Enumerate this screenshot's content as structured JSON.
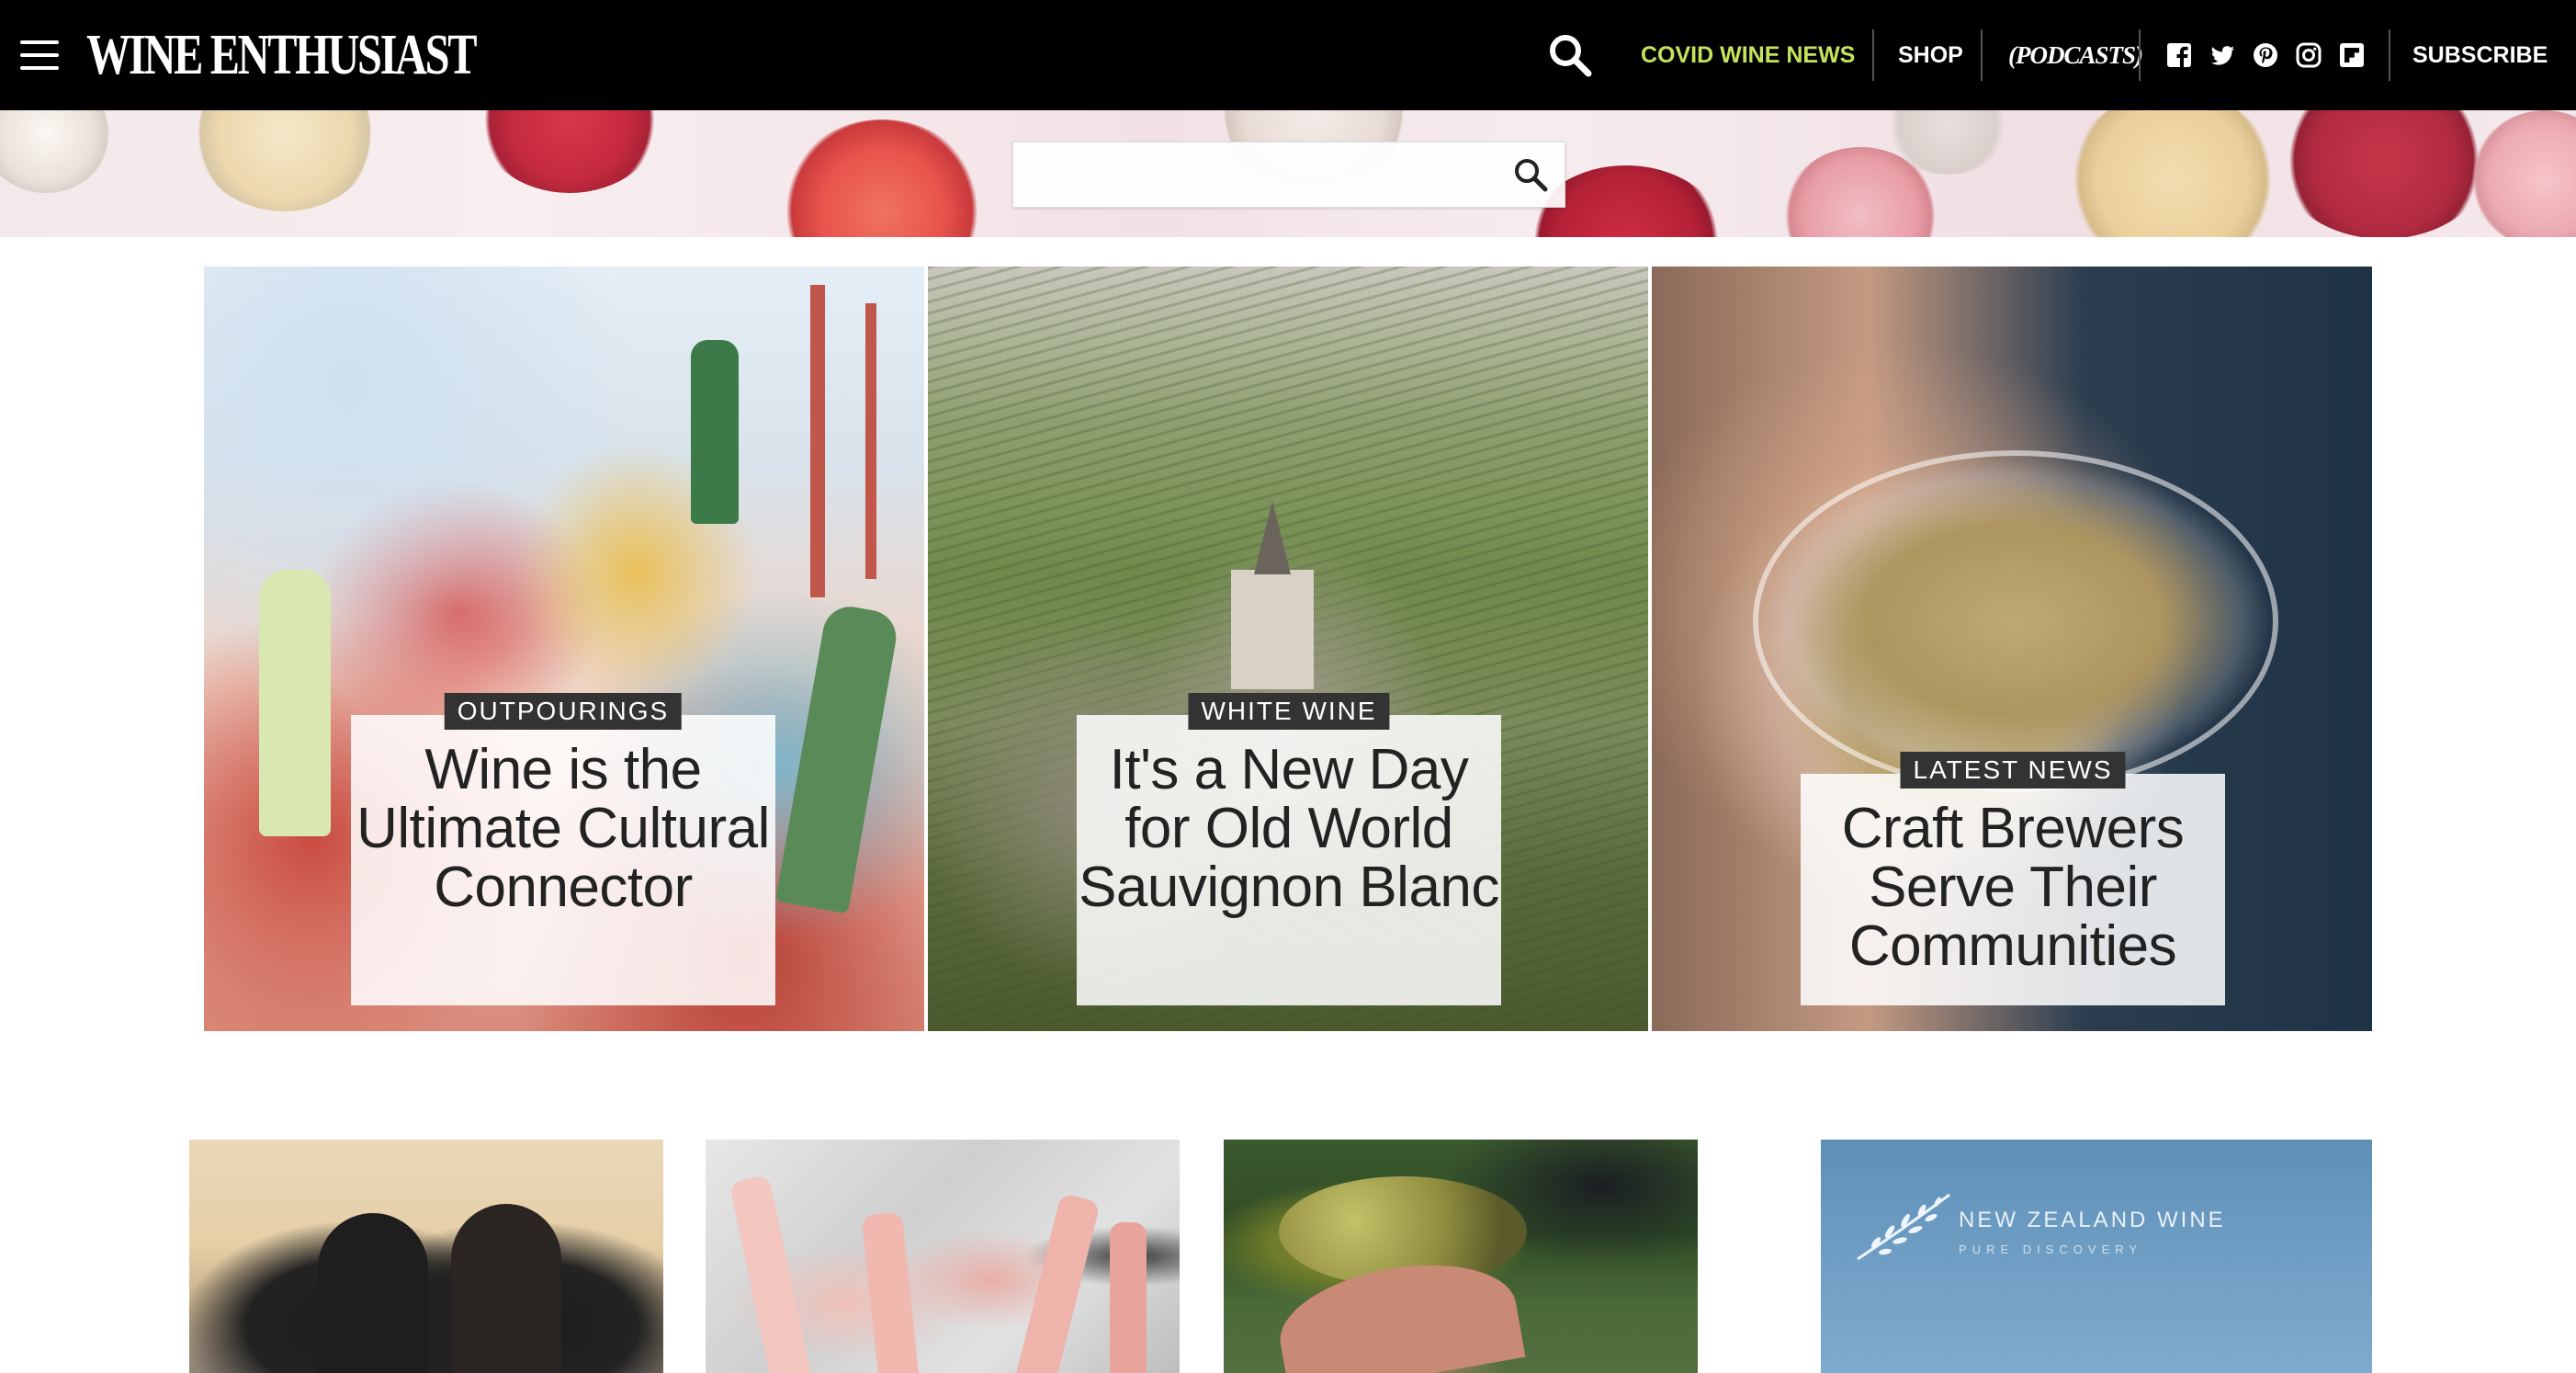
{
  "nav": {
    "logo": "WINE ENTHUSIAST",
    "links": {
      "covid": "COVID WINE NEWS",
      "shop": "SHOP",
      "podcasts": "(PODCASTS)",
      "subscribe": "SUBSCRIBE"
    },
    "covid_color": "#c5e35c",
    "social_icons": [
      "facebook-icon",
      "twitter-icon",
      "pinterest-icon",
      "instagram-icon",
      "flipboard-icon"
    ]
  },
  "banner": {
    "search_placeholder": "",
    "search_value": ""
  },
  "features": [
    {
      "tag": "OUTPOURINGS",
      "headline": "Wine is the Ultimate Cultural Connector"
    },
    {
      "tag": "WHITE WINE",
      "headline": "It's a New Day for Old World Sauvignon Blanc"
    },
    {
      "tag": "LATEST NEWS",
      "headline": "Craft Brewers Serve Their Communities"
    }
  ],
  "lower_row": {
    "ad": {
      "brand": "NEW ZEALAND WINE",
      "tagline": "PURE DISCOVERY"
    }
  }
}
